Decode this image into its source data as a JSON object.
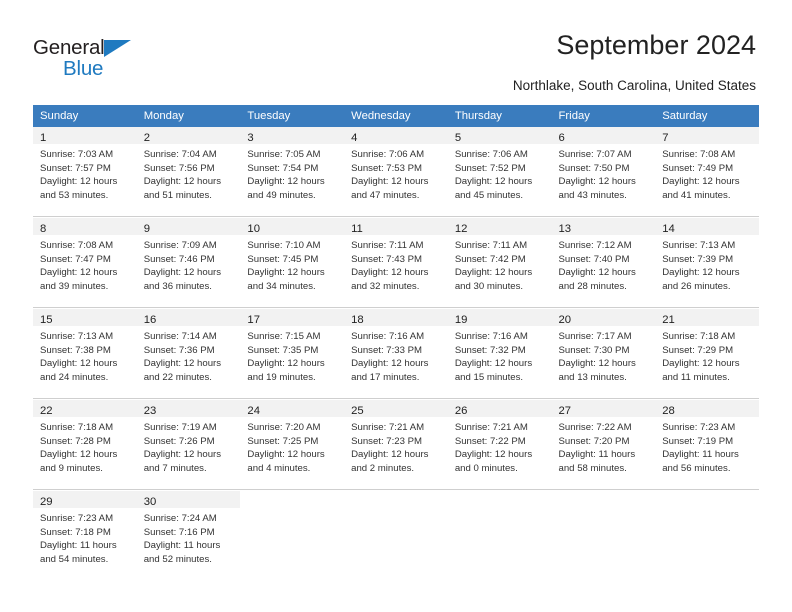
{
  "brand": {
    "name_part1": "General",
    "name_part2": "Blue",
    "accent_color": "#1f7ac0"
  },
  "header": {
    "title": "September 2024",
    "subtitle": "Northlake, South Carolina, United States",
    "header_bg_color": "#3a7cbe"
  },
  "weekdays": [
    "Sunday",
    "Monday",
    "Tuesday",
    "Wednesday",
    "Thursday",
    "Friday",
    "Saturday"
  ],
  "weeks": [
    [
      {
        "day": "1",
        "sunrise": "Sunrise: 7:03 AM",
        "sunset": "Sunset: 7:57 PM",
        "daylight1": "Daylight: 12 hours",
        "daylight2": "and 53 minutes."
      },
      {
        "day": "2",
        "sunrise": "Sunrise: 7:04 AM",
        "sunset": "Sunset: 7:56 PM",
        "daylight1": "Daylight: 12 hours",
        "daylight2": "and 51 minutes."
      },
      {
        "day": "3",
        "sunrise": "Sunrise: 7:05 AM",
        "sunset": "Sunset: 7:54 PM",
        "daylight1": "Daylight: 12 hours",
        "daylight2": "and 49 minutes."
      },
      {
        "day": "4",
        "sunrise": "Sunrise: 7:06 AM",
        "sunset": "Sunset: 7:53 PM",
        "daylight1": "Daylight: 12 hours",
        "daylight2": "and 47 minutes."
      },
      {
        "day": "5",
        "sunrise": "Sunrise: 7:06 AM",
        "sunset": "Sunset: 7:52 PM",
        "daylight1": "Daylight: 12 hours",
        "daylight2": "and 45 minutes."
      },
      {
        "day": "6",
        "sunrise": "Sunrise: 7:07 AM",
        "sunset": "Sunset: 7:50 PM",
        "daylight1": "Daylight: 12 hours",
        "daylight2": "and 43 minutes."
      },
      {
        "day": "7",
        "sunrise": "Sunrise: 7:08 AM",
        "sunset": "Sunset: 7:49 PM",
        "daylight1": "Daylight: 12 hours",
        "daylight2": "and 41 minutes."
      }
    ],
    [
      {
        "day": "8",
        "sunrise": "Sunrise: 7:08 AM",
        "sunset": "Sunset: 7:47 PM",
        "daylight1": "Daylight: 12 hours",
        "daylight2": "and 39 minutes."
      },
      {
        "day": "9",
        "sunrise": "Sunrise: 7:09 AM",
        "sunset": "Sunset: 7:46 PM",
        "daylight1": "Daylight: 12 hours",
        "daylight2": "and 36 minutes."
      },
      {
        "day": "10",
        "sunrise": "Sunrise: 7:10 AM",
        "sunset": "Sunset: 7:45 PM",
        "daylight1": "Daylight: 12 hours",
        "daylight2": "and 34 minutes."
      },
      {
        "day": "11",
        "sunrise": "Sunrise: 7:11 AM",
        "sunset": "Sunset: 7:43 PM",
        "daylight1": "Daylight: 12 hours",
        "daylight2": "and 32 minutes."
      },
      {
        "day": "12",
        "sunrise": "Sunrise: 7:11 AM",
        "sunset": "Sunset: 7:42 PM",
        "daylight1": "Daylight: 12 hours",
        "daylight2": "and 30 minutes."
      },
      {
        "day": "13",
        "sunrise": "Sunrise: 7:12 AM",
        "sunset": "Sunset: 7:40 PM",
        "daylight1": "Daylight: 12 hours",
        "daylight2": "and 28 minutes."
      },
      {
        "day": "14",
        "sunrise": "Sunrise: 7:13 AM",
        "sunset": "Sunset: 7:39 PM",
        "daylight1": "Daylight: 12 hours",
        "daylight2": "and 26 minutes."
      }
    ],
    [
      {
        "day": "15",
        "sunrise": "Sunrise: 7:13 AM",
        "sunset": "Sunset: 7:38 PM",
        "daylight1": "Daylight: 12 hours",
        "daylight2": "and 24 minutes."
      },
      {
        "day": "16",
        "sunrise": "Sunrise: 7:14 AM",
        "sunset": "Sunset: 7:36 PM",
        "daylight1": "Daylight: 12 hours",
        "daylight2": "and 22 minutes."
      },
      {
        "day": "17",
        "sunrise": "Sunrise: 7:15 AM",
        "sunset": "Sunset: 7:35 PM",
        "daylight1": "Daylight: 12 hours",
        "daylight2": "and 19 minutes."
      },
      {
        "day": "18",
        "sunrise": "Sunrise: 7:16 AM",
        "sunset": "Sunset: 7:33 PM",
        "daylight1": "Daylight: 12 hours",
        "daylight2": "and 17 minutes."
      },
      {
        "day": "19",
        "sunrise": "Sunrise: 7:16 AM",
        "sunset": "Sunset: 7:32 PM",
        "daylight1": "Daylight: 12 hours",
        "daylight2": "and 15 minutes."
      },
      {
        "day": "20",
        "sunrise": "Sunrise: 7:17 AM",
        "sunset": "Sunset: 7:30 PM",
        "daylight1": "Daylight: 12 hours",
        "daylight2": "and 13 minutes."
      },
      {
        "day": "21",
        "sunrise": "Sunrise: 7:18 AM",
        "sunset": "Sunset: 7:29 PM",
        "daylight1": "Daylight: 12 hours",
        "daylight2": "and 11 minutes."
      }
    ],
    [
      {
        "day": "22",
        "sunrise": "Sunrise: 7:18 AM",
        "sunset": "Sunset: 7:28 PM",
        "daylight1": "Daylight: 12 hours",
        "daylight2": "and 9 minutes."
      },
      {
        "day": "23",
        "sunrise": "Sunrise: 7:19 AM",
        "sunset": "Sunset: 7:26 PM",
        "daylight1": "Daylight: 12 hours",
        "daylight2": "and 7 minutes."
      },
      {
        "day": "24",
        "sunrise": "Sunrise: 7:20 AM",
        "sunset": "Sunset: 7:25 PM",
        "daylight1": "Daylight: 12 hours",
        "daylight2": "and 4 minutes."
      },
      {
        "day": "25",
        "sunrise": "Sunrise: 7:21 AM",
        "sunset": "Sunset: 7:23 PM",
        "daylight1": "Daylight: 12 hours",
        "daylight2": "and 2 minutes."
      },
      {
        "day": "26",
        "sunrise": "Sunrise: 7:21 AM",
        "sunset": "Sunset: 7:22 PM",
        "daylight1": "Daylight: 12 hours",
        "daylight2": "and 0 minutes."
      },
      {
        "day": "27",
        "sunrise": "Sunrise: 7:22 AM",
        "sunset": "Sunset: 7:20 PM",
        "daylight1": "Daylight: 11 hours",
        "daylight2": "and 58 minutes."
      },
      {
        "day": "28",
        "sunrise": "Sunrise: 7:23 AM",
        "sunset": "Sunset: 7:19 PM",
        "daylight1": "Daylight: 11 hours",
        "daylight2": "and 56 minutes."
      }
    ],
    [
      {
        "day": "29",
        "sunrise": "Sunrise: 7:23 AM",
        "sunset": "Sunset: 7:18 PM",
        "daylight1": "Daylight: 11 hours",
        "daylight2": "and 54 minutes."
      },
      {
        "day": "30",
        "sunrise": "Sunrise: 7:24 AM",
        "sunset": "Sunset: 7:16 PM",
        "daylight1": "Daylight: 11 hours",
        "daylight2": "and 52 minutes."
      },
      {
        "day": "",
        "sunrise": "",
        "sunset": "",
        "daylight1": "",
        "daylight2": ""
      },
      {
        "day": "",
        "sunrise": "",
        "sunset": "",
        "daylight1": "",
        "daylight2": ""
      },
      {
        "day": "",
        "sunrise": "",
        "sunset": "",
        "daylight1": "",
        "daylight2": ""
      },
      {
        "day": "",
        "sunrise": "",
        "sunset": "",
        "daylight1": "",
        "daylight2": ""
      },
      {
        "day": "",
        "sunrise": "",
        "sunset": "",
        "daylight1": "",
        "daylight2": ""
      }
    ]
  ]
}
